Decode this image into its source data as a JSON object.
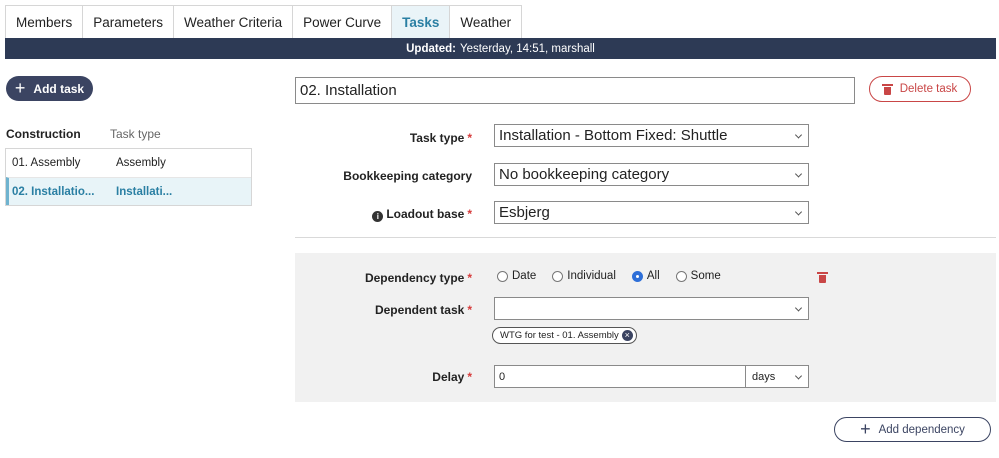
{
  "tabs": [
    "Members",
    "Parameters",
    "Weather Criteria",
    "Power Curve",
    "Tasks",
    "Weather"
  ],
  "active_tab": "Tasks",
  "banner": {
    "label": "Updated:",
    "value": "Yesterday, 14:51, marshall"
  },
  "left": {
    "add_task_label": "Add task",
    "columns": [
      "Construction",
      "Task type"
    ],
    "tasks": [
      {
        "name": "01. Assembly",
        "type": "Assembly",
        "selected": false
      },
      {
        "name": "02. Installatio...",
        "type": "Installati...",
        "selected": true
      }
    ]
  },
  "task": {
    "name": "02. Installation",
    "delete_label": "Delete task",
    "task_type_label": "Task type",
    "task_type_value": "Installation - Bottom Fixed: Shuttle",
    "bookkeeping_label": "Bookkeeping category",
    "bookkeeping_value": "No bookkeeping category",
    "loadout_label": "Loadout base",
    "loadout_value": "Esbjerg"
  },
  "dependency": {
    "type_label": "Dependency type",
    "options": [
      "Date",
      "Individual",
      "All",
      "Some"
    ],
    "selected": "All",
    "task_label": "Dependent task",
    "task_value": "",
    "chip": "WTG for test - 01. Assembly",
    "delay_label": "Delay",
    "delay_value": "0",
    "delay_unit": "days",
    "add_label": "Add dependency"
  },
  "required_marker": "*",
  "colors": {
    "navy": "#2d3a55",
    "accent": "#2a7fa3",
    "danger": "#c94646",
    "radio": "#2e6fd8"
  }
}
